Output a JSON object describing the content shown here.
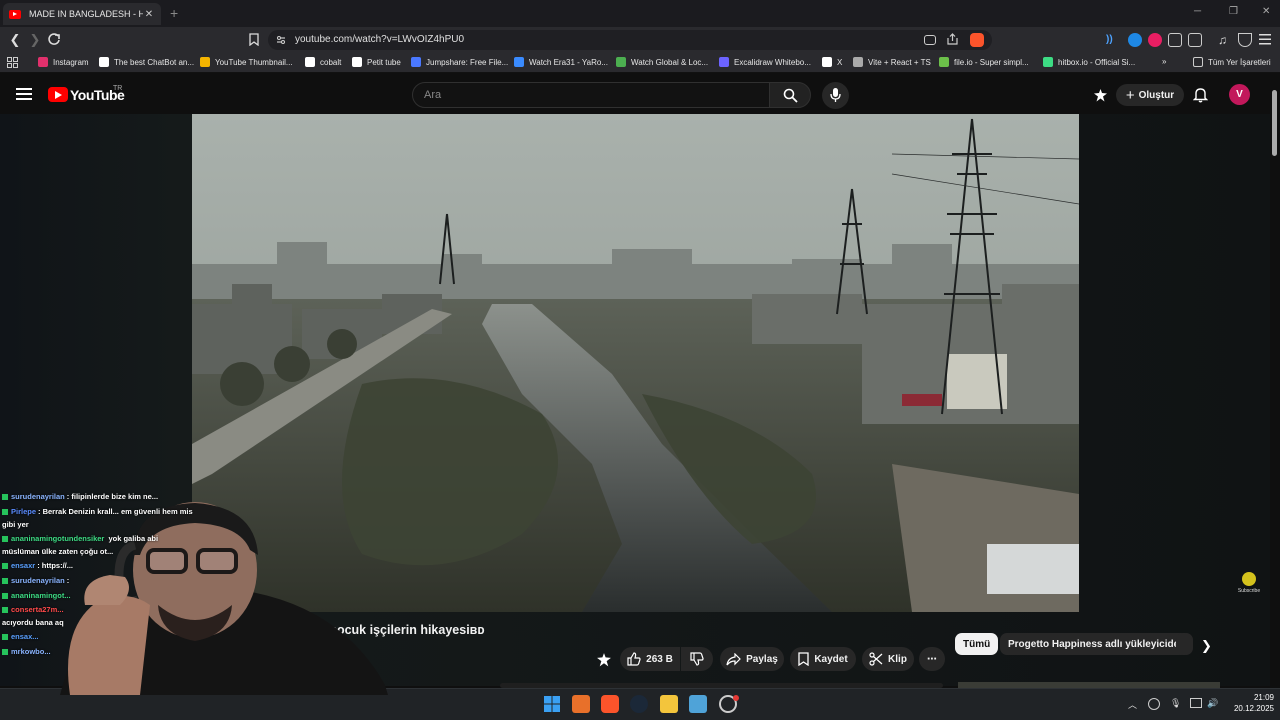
{
  "browser": {
    "tab_title": "MADE IN BANGLADESH - Hızlı M",
    "tab_close": "✕",
    "new_tab": "+",
    "url": "youtube.com/watch?v=LWvOIZ4hPU0",
    "bookmarks": [
      {
        "label": "Instagram",
        "color": "#e1306c"
      },
      {
        "label": "The best ChatBot an...",
        "color": "#ffffff"
      },
      {
        "label": "YouTube Thumbnail...",
        "color": "#f4b400"
      },
      {
        "label": "cobalt",
        "color": "#ffffff"
      },
      {
        "label": "Petit tube",
        "color": "#ffffff"
      },
      {
        "label": "Jumpshare: Free File...",
        "color": "#4a78ff"
      },
      {
        "label": "Watch Era31 - YaRo...",
        "color": "#3a8bff"
      },
      {
        "label": "Watch Global & Loc...",
        "color": "#4caf50"
      },
      {
        "label": "Excalidraw Whitebo...",
        "color": "#6c63ff"
      },
      {
        "label": "X",
        "color": "#ffffff"
      },
      {
        "label": "Vite + React + TS",
        "color": "#aaaaaa"
      },
      {
        "label": "file.io - Super simpl...",
        "color": "#6cc04a"
      },
      {
        "label": "hitbox.io - Official Si...",
        "color": "#3ddc84"
      }
    ],
    "bookmarks_more": "»",
    "all_bookmarks": "Tüm Yer İşaretleri"
  },
  "youtube": {
    "logo_text": "YouTube",
    "country": "TR",
    "search_placeholder": "Ara",
    "create_label": "Oluştur",
    "avatar_letter": "V",
    "video_title": "çocuk işçilerin hikayesiʙᴅ",
    "likes": "263 B",
    "share": "Paylaş",
    "save": "Kaydet",
    "clip": "Klip",
    "more": "⋯",
    "chips": [
      "Tümü",
      "Progetto Happiness adlı yükleyiciden"
    ],
    "watermark": "Subscribe"
  },
  "chat": [
    {
      "user": "surudenayrilan",
      "color": "#8ab4ff",
      "text": ": filipinlerde bize kim ne..."
    },
    {
      "user": "Pirlepe",
      "color": "#5a8cff",
      "text": ": Berrak Denizin krall...               em güvenli hem mis"
    },
    {
      "user": "",
      "color": "#ffffff",
      "text": "gibi yer"
    },
    {
      "user": "ananinamingotundensiker",
      "color": "#3ddc84",
      "text": "                    yok galiba abi"
    },
    {
      "user": "",
      "color": "#ffffff",
      "text": "müslüman ülke zaten çoğu ot..."
    },
    {
      "user": "ensaxr",
      "color": "#5aa0ff",
      "text": ": https://..."
    },
    {
      "user": "surudenayrilan",
      "color": "#8ab4ff",
      "text": ":"
    },
    {
      "user": "ananinamingot...",
      "color": "#3ddc84",
      "text": ""
    },
    {
      "user": "conserta27m...",
      "color": "#ff4a4a",
      "text": ""
    },
    {
      "user": "",
      "color": "#ffffff",
      "text": "acıyordu bana aq"
    },
    {
      "user": "ensax...",
      "color": "#5aa0ff",
      "text": ""
    },
    {
      "user": "mrkowbo...",
      "color": "#8ab4ff",
      "text": ""
    }
  ],
  "taskbar": {
    "time": "21:09",
    "date": "20.12.2025"
  },
  "colors": {
    "accent": "#ff0000",
    "bg": "#0f0f0f",
    "chip_active": "#f1f1f1"
  }
}
